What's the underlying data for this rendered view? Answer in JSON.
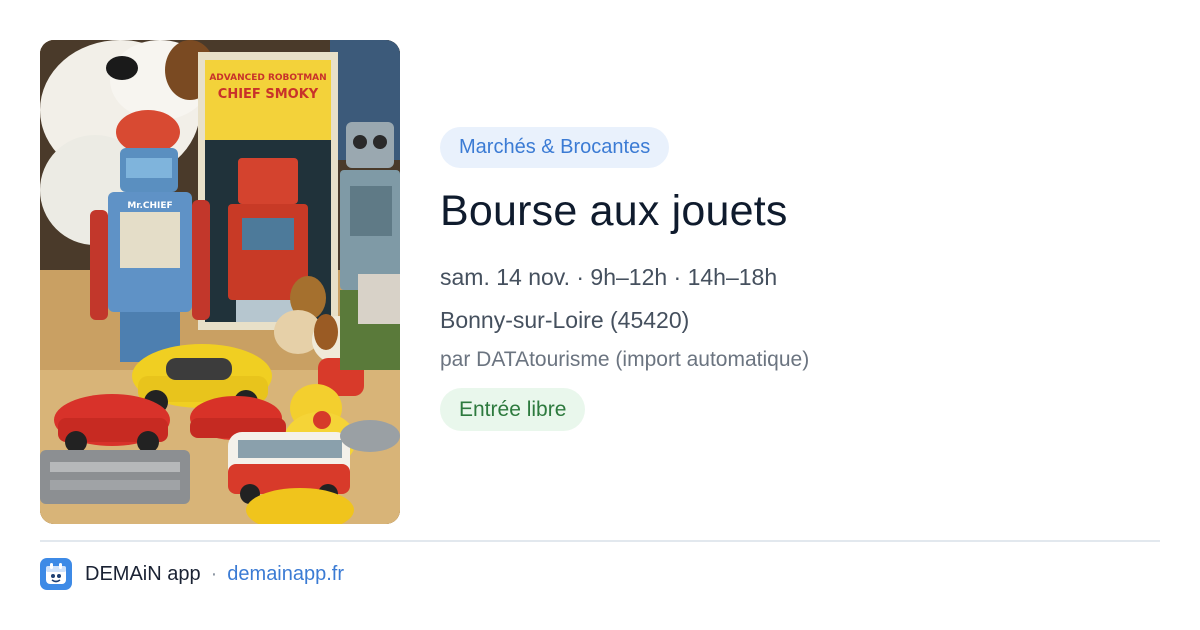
{
  "event": {
    "category": "Marchés & Brocantes",
    "title": "Bourse aux jouets",
    "when": "sam. 14 nov. · 9h–12h · 14h–18h",
    "where": "Bonny-sur-Loire (45420)",
    "by": "par DATAtourisme (import automatique)",
    "price": "Entrée libre"
  },
  "photo": {
    "box_text_1": "ADVANCED ROBOTMAN",
    "box_text_2": "CHIEF SMOKY",
    "robot_label": "Mr.CHIEF"
  },
  "footer": {
    "app_name": "DEMAiN app",
    "separator": "·",
    "site": "demainapp.fr",
    "icon": "demain-app-icon"
  },
  "colors": {
    "accent_blue": "#3b7bd4",
    "category_bg": "#e9f1fc",
    "price_green": "#2d7a3e",
    "price_bg": "#e9f7ec"
  }
}
